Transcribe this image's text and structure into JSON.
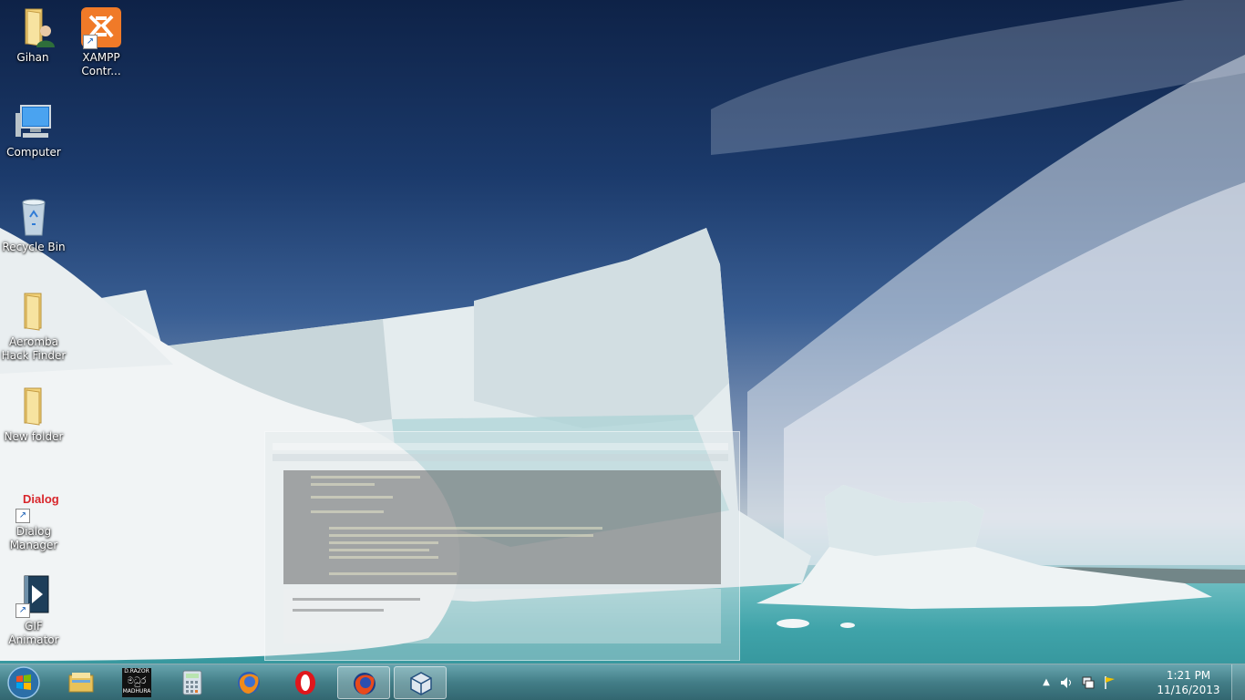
{
  "desktop": {
    "icons": [
      {
        "label_line1": "Gihan",
        "label_line2": "",
        "icon": "user-folder-icon"
      },
      {
        "label_line1": "XAMPP",
        "label_line2": "Contr...",
        "icon": "xampp-icon"
      },
      {
        "label_line1": "Computer",
        "label_line2": "",
        "icon": "computer-icon"
      },
      {
        "label_line1": "Recycle Bin",
        "label_line2": "",
        "icon": "recycle-bin-icon"
      },
      {
        "label_line1": "Aeromba",
        "label_line2": "Hack Finder",
        "icon": "folder-icon"
      },
      {
        "label_line1": "New folder",
        "label_line2": "",
        "icon": "folder-icon"
      },
      {
        "label_line1": "Dialog",
        "label_line2": "Manager",
        "icon": "dialog-icon"
      },
      {
        "label_line1": "GIF Animator",
        "label_line2": "",
        "icon": "gif-animator-icon"
      }
    ],
    "dialog_logo_text": "Dialog"
  },
  "taskbar": {
    "items": [
      {
        "name": "windows-explorer",
        "icon": "folder-library-icon"
      },
      {
        "name": "sinhala-app",
        "icon": "app-badge-icon",
        "badge_top": "D.RAZOR",
        "badge_mid": "මධුර",
        "badge_bottom": "MADHURA"
      },
      {
        "name": "calculator",
        "icon": "calculator-icon"
      },
      {
        "name": "firefox",
        "icon": "firefox-icon"
      },
      {
        "name": "opera",
        "icon": "opera-icon"
      },
      {
        "name": "firefox-nightly",
        "icon": "firefox-nightly-icon"
      },
      {
        "name": "virtualbox",
        "icon": "cube-icon"
      }
    ],
    "clock_time": "1:21 PM",
    "clock_date": "11/16/2013"
  },
  "colors": {
    "sky": "#1b3a6b",
    "sea": "#3fa3a9",
    "ice": "#e8eef0",
    "taskbar": "#4e8590"
  }
}
